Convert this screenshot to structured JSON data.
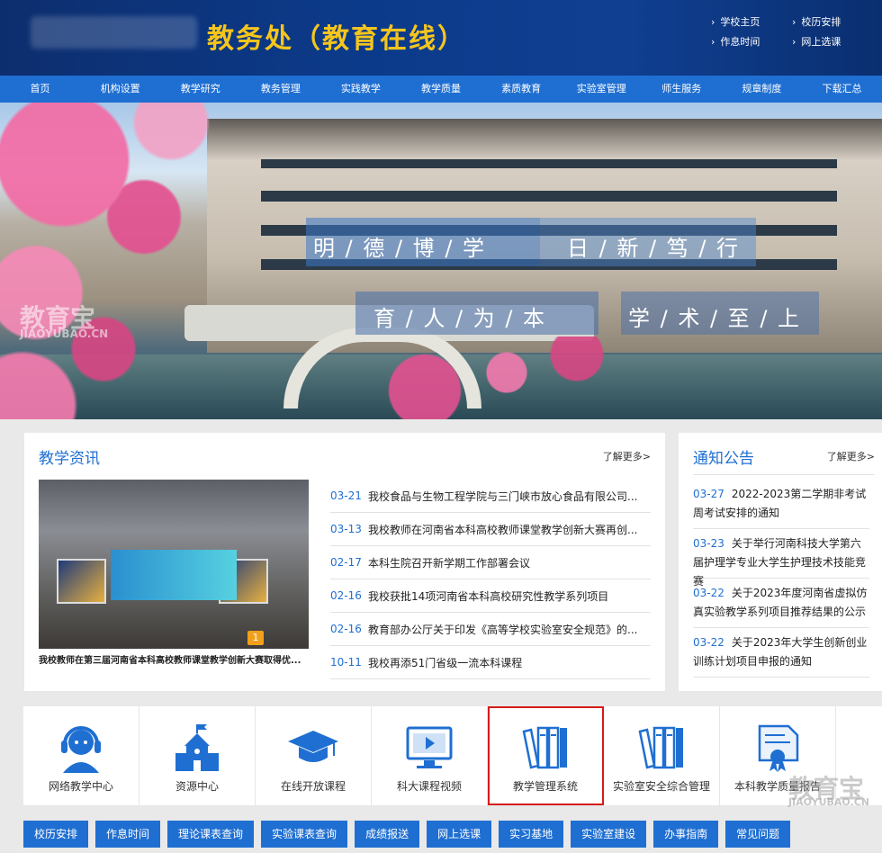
{
  "header": {
    "site_title": "教务处（教育在线）",
    "quick_links": [
      "学校主页",
      "校历安排",
      "作息时间",
      "网上选课"
    ]
  },
  "nav": [
    "首页",
    "机构设置",
    "教学研究",
    "教务管理",
    "实践教学",
    "教学质量",
    "素质教育",
    "实验室管理",
    "师生服务",
    "规章制度",
    "下载汇总"
  ],
  "banner": {
    "motto_line1_a": "明 / 德 / 博 / 学",
    "motto_line1_b": "日 / 新 / 笃 / 行",
    "motto_line2_a": "育 / 人 / 为 / 本",
    "motto_line2_b": "学 / 术 / 至 / 上",
    "watermark_cn": "教育宝",
    "watermark_en": "JIAOYUBAO.CN"
  },
  "news": {
    "title": "教学资讯",
    "more": "了解更多>",
    "photo_caption": "我校教师在第三届河南省本科高校教师课堂教学创新大赛取得优...",
    "photo_badge": "1",
    "items": [
      {
        "date": "03-21",
        "text": "我校食品与生物工程学院与三门峡市放心食品有限公司..."
      },
      {
        "date": "03-13",
        "text": "我校教师在河南省本科高校教师课堂教学创新大赛再创..."
      },
      {
        "date": "02-17",
        "text": "本科生院召开新学期工作部署会议"
      },
      {
        "date": "02-16",
        "text": "我校获批14项河南省本科高校研究性教学系列项目"
      },
      {
        "date": "02-16",
        "text": "教育部办公厅关于印发《高等学校实验室安全规范》的..."
      },
      {
        "date": "10-11",
        "text": "我校再添51门省级一流本科课程"
      }
    ]
  },
  "notices": {
    "title": "通知公告",
    "more": "了解更多>",
    "items": [
      {
        "date": "03-27",
        "text": "2022-2023第二学期非考试周考试安排的通知"
      },
      {
        "date": "03-23",
        "text": "关于举行河南科技大学第六届护理学专业大学生护理技术技能竞赛"
      },
      {
        "date": "03-22",
        "text": "关于2023年度河南省虚拟仿真实验教学系列项目推荐结果的公示"
      },
      {
        "date": "03-22",
        "text": "关于2023年大学生创新创业训练计划项目申报的通知"
      }
    ]
  },
  "services": [
    {
      "label": "网络教学中心",
      "icon": "headset-person-icon"
    },
    {
      "label": "资源中心",
      "icon": "school-building-icon"
    },
    {
      "label": "在线开放课程",
      "icon": "graduation-cap-icon"
    },
    {
      "label": "科大课程视频",
      "icon": "video-monitor-icon"
    },
    {
      "label": "教学管理系统",
      "icon": "books-icon"
    },
    {
      "label": "实验室安全综合管理",
      "icon": "books-icon"
    },
    {
      "label": "本科教学质量报告",
      "icon": "certificate-icon"
    }
  ],
  "bottom_links": [
    "校历安排",
    "作息时间",
    "理论课表查询",
    "实验课表查询",
    "成绩报送",
    "网上选课",
    "实习基地",
    "实验室建设",
    "办事指南",
    "常见问题"
  ],
  "colors": {
    "primary": "#1f6fd2",
    "title_gold": "#f5c51d",
    "highlight_red": "#d51b1b"
  }
}
